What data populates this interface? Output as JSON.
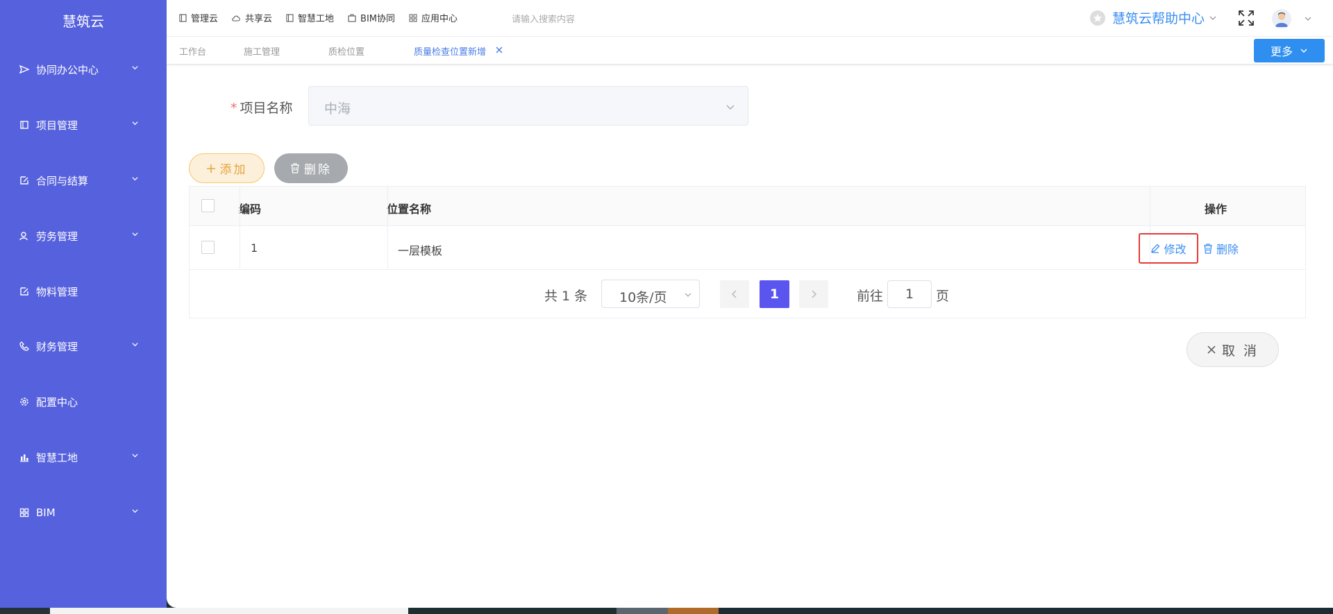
{
  "app": {
    "logo": "慧筑云"
  },
  "sidebar": {
    "items": [
      {
        "label": "协同办公中心",
        "icon": "send-icon",
        "has_children": true
      },
      {
        "label": "项目管理",
        "icon": "book-icon",
        "has_children": true
      },
      {
        "label": "合同与结算",
        "icon": "edit-doc-icon",
        "has_children": true
      },
      {
        "label": "劳务管理",
        "icon": "user-group-icon",
        "has_children": true
      },
      {
        "label": "物料管理",
        "icon": "edit-doc-icon",
        "has_children": false
      },
      {
        "label": "财务管理",
        "icon": "phone-icon",
        "has_children": true
      },
      {
        "label": "配置中心",
        "icon": "gear-icon",
        "has_children": false
      },
      {
        "label": "智慧工地",
        "icon": "bar-chart-icon",
        "has_children": true
      },
      {
        "label": "BIM",
        "icon": "grid-icon",
        "has_children": true
      }
    ]
  },
  "topnav": {
    "items": [
      "管理云",
      "共享云",
      "智慧工地",
      "BIM协同",
      "应用中心"
    ],
    "search_placeholder": "请输入搜索内容",
    "help_label": "慧筑云帮助中心"
  },
  "tabs": {
    "items": [
      "工作台",
      "施工管理",
      "质检位置",
      "质量检查位置新增"
    ],
    "active_index": 3,
    "more_label": "更多"
  },
  "form": {
    "project_label": "项目名称",
    "required_mark": "*",
    "project_value": "中海"
  },
  "toolbar": {
    "add_label": "添加",
    "delete_label": "删除"
  },
  "table": {
    "headers": {
      "code": "编码",
      "location": "位置名称",
      "ops": "操作"
    },
    "rows": [
      {
        "code": "1",
        "location": "一层模板",
        "edit_label": "修改",
        "delete_label": "删除"
      }
    ]
  },
  "pagination": {
    "total_text": "共 1 条",
    "page_size": "10条/页",
    "current_page": "1",
    "goto_label": "前往",
    "goto_value": "1",
    "goto_unit": "页"
  },
  "actions": {
    "cancel_label": "取 消"
  },
  "colors": {
    "sidebar": "#5661dd",
    "primary": "#2f8ff0",
    "page_active": "#5b55f0",
    "warning": "#e6a23c",
    "danger_outline": "#e53935"
  }
}
